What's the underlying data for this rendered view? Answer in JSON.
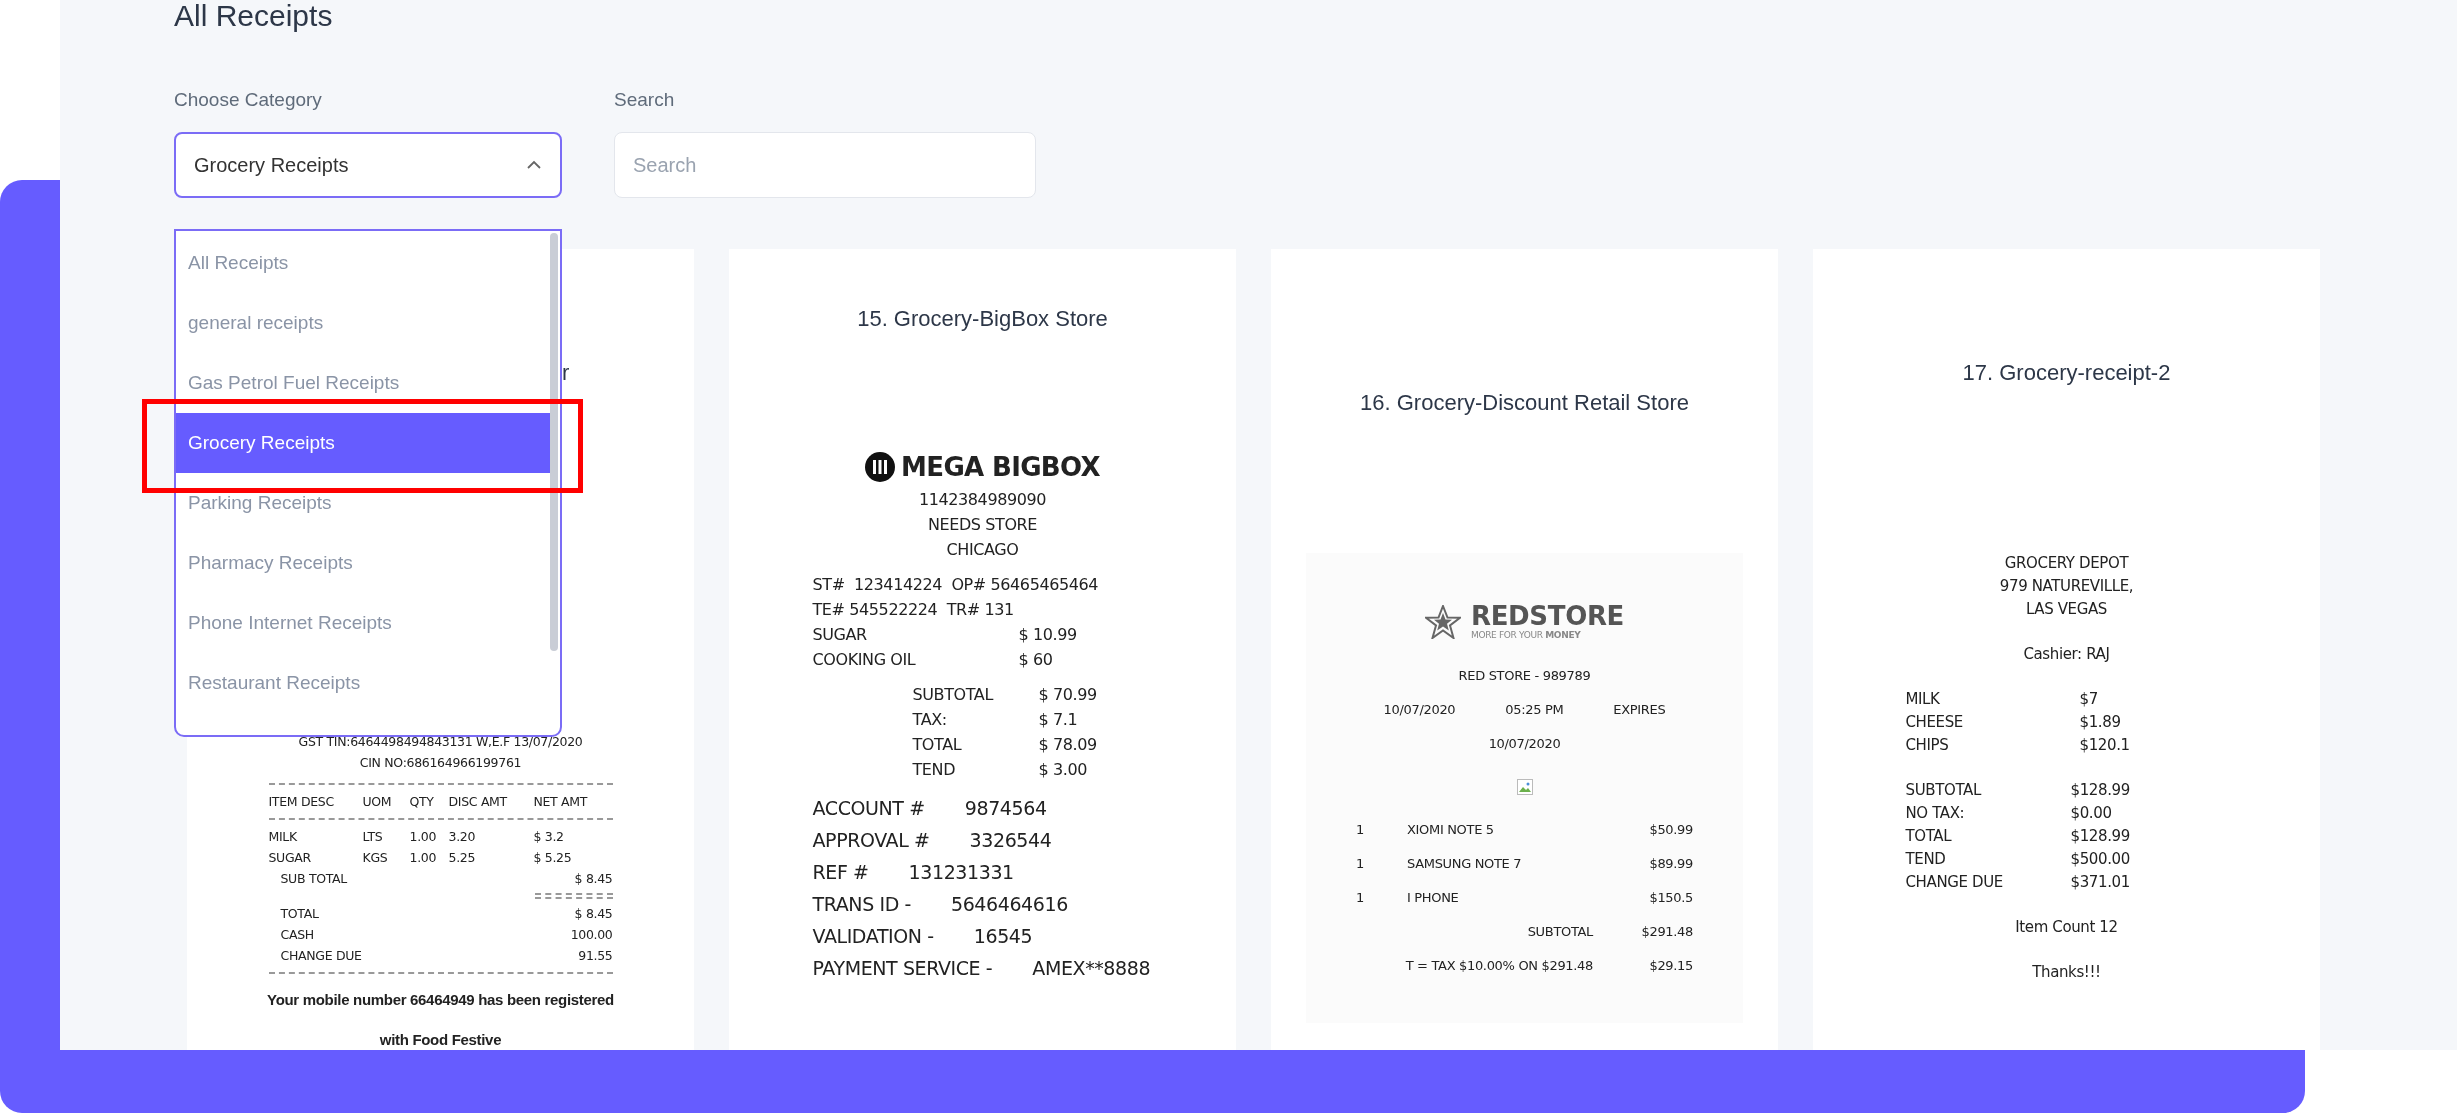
{
  "page": {
    "title": "All Receipts"
  },
  "filters": {
    "category": {
      "label": "Choose Category",
      "value": "Grocery Receipts",
      "expanded": true,
      "options": [
        {
          "label": "All Receipts",
          "selected": false
        },
        {
          "label": "general receipts",
          "selected": false
        },
        {
          "label": "Gas Petrol Fuel Receipts",
          "selected": false
        },
        {
          "label": "Grocery Receipts",
          "selected": true
        },
        {
          "label": "Parking Receipts",
          "selected": false
        },
        {
          "label": "Pharmacy Receipts",
          "selected": false
        },
        {
          "label": "Phone Internet Receipts",
          "selected": false
        },
        {
          "label": "Restaurant Receipts",
          "selected": false
        }
      ]
    },
    "search": {
      "label": "Search",
      "placeholder": "Search"
    }
  },
  "annotation": {
    "kind": "box"
  },
  "receipts": [
    {
      "title": "r",
      "sections": [
        [
          {
            "kind": "center",
            "text": "GST TIN:6464498494843131 W,E.F 13/07/2020"
          },
          {
            "kind": "center",
            "text": "CIN NO:686164966199761"
          }
        ],
        [
          {
            "kind": "dash"
          },
          {
            "kind": "row",
            "cells": [
              "ITEM DESC",
              "UOM",
              "QTY",
              "DISC AMT",
              "NET AMT"
            ]
          },
          {
            "kind": "dash"
          },
          {
            "kind": "row",
            "cells": [
              "MILK",
              "LTS",
              "1.00",
              "3.20",
              "$ 3.2"
            ]
          },
          {
            "kind": "row",
            "cells": [
              "SUGAR",
              "KGS",
              "1.00",
              "5.25",
              "$ 5.25"
            ]
          },
          {
            "kind": "pair",
            "cells": [
              "SUB TOTAL",
              "$ 8.45"
            ]
          },
          {
            "kind": "double_dash"
          },
          {
            "kind": "pair",
            "cells": [
              "TOTAL",
              "$ 8.45"
            ]
          },
          {
            "kind": "pair",
            "cells": [
              "CASH",
              "100.00"
            ]
          },
          {
            "kind": "pair",
            "cells": [
              "CHANGE DUE",
              "91.55"
            ]
          },
          {
            "kind": "dash"
          },
          {
            "kind": "bold",
            "text": "Your mobile number 66464949 has been registered with Food Festive"
          }
        ]
      ]
    },
    {
      "title": "15. Grocery-BigBox Store",
      "sections": [
        [
          {
            "kind": "logo",
            "text": "MEGA BIGBOX"
          },
          {
            "kind": "center",
            "text": "1142384989090"
          },
          {
            "kind": "center",
            "text": "NEEDS STORE"
          },
          {
            "kind": "center",
            "text": "CHICAGO"
          }
        ],
        [
          {
            "kind": "text",
            "text": "ST#  123414224  OP# 56465465464"
          },
          {
            "kind": "text",
            "text": "TE# 545522224  TR# 131"
          },
          {
            "kind": "pair",
            "cells": [
              "SUGAR",
              "$ 10.99"
            ]
          },
          {
            "kind": "pair",
            "cells": [
              "COOKING OIL",
              "$ 60"
            ]
          }
        ],
        [
          {
            "kind": "total",
            "cells": [
              "SUBTOTAL",
              "$ 70.99"
            ]
          },
          {
            "kind": "total",
            "cells": [
              "TAX:",
              "$ 7.1"
            ]
          },
          {
            "kind": "total",
            "cells": [
              "TOTAL",
              "$ 78.09"
            ]
          },
          {
            "kind": "total",
            "cells": [
              "TEND",
              "$ 3.00"
            ]
          }
        ],
        [
          {
            "kind": "field",
            "cells": [
              "ACCOUNT #",
              "9874564"
            ]
          },
          {
            "kind": "field",
            "cells": [
              "APPROVAL #",
              "3326544"
            ]
          },
          {
            "kind": "field",
            "cells": [
              "REF #",
              "131231331"
            ]
          },
          {
            "kind": "field",
            "cells": [
              "TRANS ID -",
              "5646464616"
            ]
          },
          {
            "kind": "field",
            "cells": [
              "VALIDATION -",
              "16545"
            ]
          },
          {
            "kind": "field",
            "cells": [
              "PAYMENT SERVICE -",
              "AMEX**8888"
            ]
          }
        ]
      ]
    },
    {
      "title": "16. Grocery-Discount Retail Store",
      "sections": [
        [
          {
            "kind": "brand",
            "text": "REDSTORE",
            "tagline": "MORE FOR YOUR **MONEY**"
          }
        ],
        [
          {
            "kind": "center",
            "text": "RED STORE - 989789"
          },
          {
            "kind": "spread",
            "cells": [
              "10/07/2020",
              "05:25 PM",
              "EXPIRES"
            ]
          },
          {
            "kind": "center",
            "text": "10/07/2020"
          }
        ],
        [
          {
            "kind": "broken_image"
          }
        ],
        [
          {
            "kind": "item",
            "cells": [
              "1",
              "XIOMI NOTE 5",
              "$50.99"
            ]
          },
          {
            "kind": "item",
            "cells": [
              "1",
              "SAMSUNG NOTE 7",
              "$89.99"
            ]
          },
          {
            "kind": "item",
            "cells": [
              "1",
              "I PHONE",
              "$150.5"
            ]
          },
          {
            "kind": "total",
            "cells": [
              "SUBTOTAL",
              "$291.48"
            ]
          },
          {
            "kind": "total",
            "cells": [
              "T = TAX $10.00% ON $291.48",
              "$29.15"
            ]
          }
        ]
      ]
    },
    {
      "title": "17. Grocery-receipt-2",
      "sections": [
        [
          {
            "kind": "center",
            "text": "GROCERY DEPOT"
          },
          {
            "kind": "center",
            "text": "979 NATUREVILLE,"
          },
          {
            "kind": "center",
            "text": "LAS VEGAS"
          }
        ],
        [
          {
            "kind": "center",
            "text": "Cashier: RAJ"
          }
        ],
        [
          {
            "kind": "pair",
            "cells": [
              "MILK",
              "$7"
            ]
          },
          {
            "kind": "pair",
            "cells": [
              "CHEESE",
              "$1.89"
            ]
          },
          {
            "kind": "pair",
            "cells": [
              "CHIPS",
              "$120.1"
            ]
          }
        ],
        [
          {
            "kind": "total",
            "cells": [
              "SUBTOTAL",
              "$128.99"
            ]
          },
          {
            "kind": "total",
            "cells": [
              "NO TAX:",
              "$0.00"
            ]
          },
          {
            "kind": "total",
            "cells": [
              "TOTAL",
              "$128.99"
            ]
          },
          {
            "kind": "total",
            "cells": [
              "TEND",
              "$500.00"
            ]
          },
          {
            "kind": "total",
            "cells": [
              "CHANGE DUE",
              "$371.01"
            ]
          }
        ],
        [
          {
            "kind": "center",
            "text": "Item Count 12"
          }
        ],
        [
          {
            "kind": "center",
            "text": "Thanks!!!"
          }
        ]
      ]
    }
  ]
}
